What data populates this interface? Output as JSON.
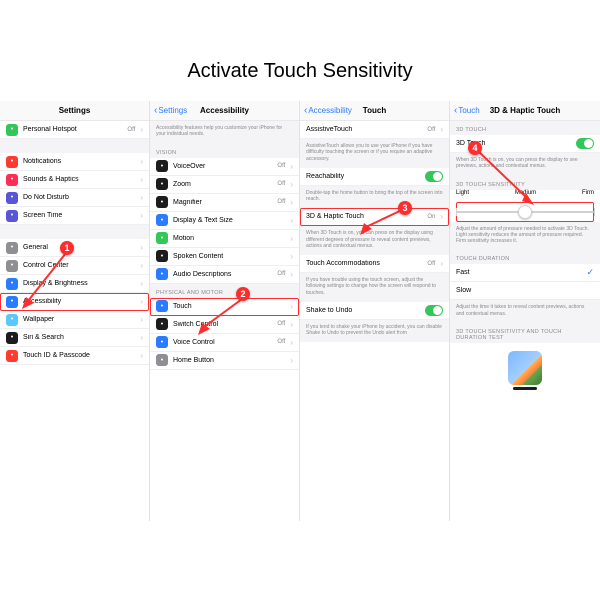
{
  "title": "Activate Touch Sensitivity",
  "callouts": [
    "1",
    "2",
    "3",
    "4"
  ],
  "p1": {
    "header": "Settings",
    "rows": [
      {
        "icon": "link",
        "bg": "i-green",
        "label": "Personal Hotspot",
        "value": "Off",
        "chevron": true
      },
      {
        "spacer": true
      },
      {
        "icon": "bell",
        "bg": "i-red",
        "label": "Notifications",
        "chevron": true
      },
      {
        "icon": "speaker",
        "bg": "i-pink",
        "label": "Sounds & Haptics",
        "chevron": true
      },
      {
        "icon": "moon",
        "bg": "i-purple",
        "label": "Do Not Disturb",
        "chevron": true
      },
      {
        "icon": "hourglass",
        "bg": "i-purple",
        "label": "Screen Time",
        "chevron": true
      },
      {
        "spacer": true
      },
      {
        "icon": "gear",
        "bg": "i-gray",
        "label": "General",
        "chevron": true
      },
      {
        "icon": "sliders",
        "bg": "i-gray",
        "label": "Control Center",
        "chevron": true
      },
      {
        "icon": "sun",
        "bg": "i-blue",
        "label": "Display & Brightness",
        "chevron": true
      },
      {
        "icon": "person",
        "bg": "i-blue",
        "label": "Accessibility",
        "chevron": true,
        "highlight": true
      },
      {
        "icon": "flower",
        "bg": "i-teal",
        "label": "Wallpaper",
        "chevron": true
      },
      {
        "icon": "siri",
        "bg": "i-black",
        "label": "Siri & Search",
        "chevron": true
      },
      {
        "icon": "touchid",
        "bg": "i-red",
        "label": "Touch ID & Passcode",
        "chevron": true
      }
    ]
  },
  "p2": {
    "back": "Settings",
    "header": "Accessibility",
    "intro": "Accessibility features help you customize your iPhone for your individual needs.",
    "sect_vision": "VISION",
    "vision_rows": [
      {
        "icon": "vo",
        "bg": "i-black",
        "label": "VoiceOver",
        "value": "Off",
        "chevron": true
      },
      {
        "icon": "zoom",
        "bg": "i-black",
        "label": "Zoom",
        "value": "Off",
        "chevron": true
      },
      {
        "icon": "mag",
        "bg": "i-black",
        "label": "Magnifier",
        "value": "Off",
        "chevron": true
      },
      {
        "icon": "Aa",
        "bg": "i-blue",
        "label": "Display & Text Size",
        "chevron": true
      },
      {
        "icon": "motion",
        "bg": "i-green",
        "label": "Motion",
        "chevron": true
      },
      {
        "icon": "speak",
        "bg": "i-black",
        "label": "Spoken Content",
        "chevron": true
      },
      {
        "icon": "ad",
        "bg": "i-blue",
        "label": "Audio Descriptions",
        "value": "Off",
        "chevron": true
      }
    ],
    "sect_motor": "PHYSICAL AND MOTOR",
    "motor_rows": [
      {
        "icon": "touch",
        "bg": "i-blue",
        "label": "Touch",
        "chevron": true,
        "highlight": true
      },
      {
        "icon": "switch",
        "bg": "i-black",
        "label": "Switch Control",
        "value": "Off",
        "chevron": true
      },
      {
        "icon": "voice",
        "bg": "i-blue",
        "label": "Voice Control",
        "value": "Off",
        "chevron": true
      },
      {
        "icon": "home",
        "bg": "i-gray",
        "label": "Home Button",
        "chevron": true
      }
    ]
  },
  "p3": {
    "back": "Accessibility",
    "header": "Touch",
    "assistive": {
      "label": "AssistiveTouch",
      "value": "Off",
      "desc": "AssistiveTouch allows you to use your iPhone if you have difficulty touching the screen or if you require an adaptive accessory."
    },
    "reach": {
      "label": "Reachability",
      "desc": "Double-tap the home button to bring the top of the screen into reach.",
      "on": true
    },
    "haptic": {
      "label": "3D & Haptic Touch",
      "value": "On",
      "desc": "When 3D Touch is on, you can press on the display using different degrees of pressure to reveal content previews, actions and contextual menus.",
      "highlight": true
    },
    "accom": {
      "label": "Touch Accommodations",
      "value": "Off",
      "desc": "If you have trouble using the touch screen, adjust the following settings to change how the screen will respond to touches."
    },
    "shake": {
      "label": "Shake to Undo",
      "on": true,
      "desc": "If you tend to shake your iPhone by accident, you can disable Shake to Undo to prevent the Undo alert from"
    }
  },
  "p4": {
    "back": "Touch",
    "header": "3D & Haptic Touch",
    "sect1": "3D TOUCH",
    "row1": {
      "label": "3D Touch",
      "on": true,
      "desc": "When 3D Touch is on, you can press the display to see previews, actions and contextual menus."
    },
    "sect2": "3D TOUCH SENSITIVITY",
    "slider": {
      "labels": [
        "Light",
        "Medium",
        "Firm"
      ],
      "position": "Medium",
      "desc": "Adjust the amount of pressure needed to activate 3D Touch. Light sensitivity reduces the amount of pressure required. Firm sensitivity increases it."
    },
    "sect3": "TOUCH DURATION",
    "dur": [
      {
        "label": "Fast",
        "checked": true
      },
      {
        "label": "Slow",
        "checked": false
      }
    ],
    "dur_desc": "Adjust the time it takes to reveal content previews, actions and contextual menus.",
    "sect4": "3D TOUCH SENSITIVITY AND TOUCH DURATION TEST"
  }
}
